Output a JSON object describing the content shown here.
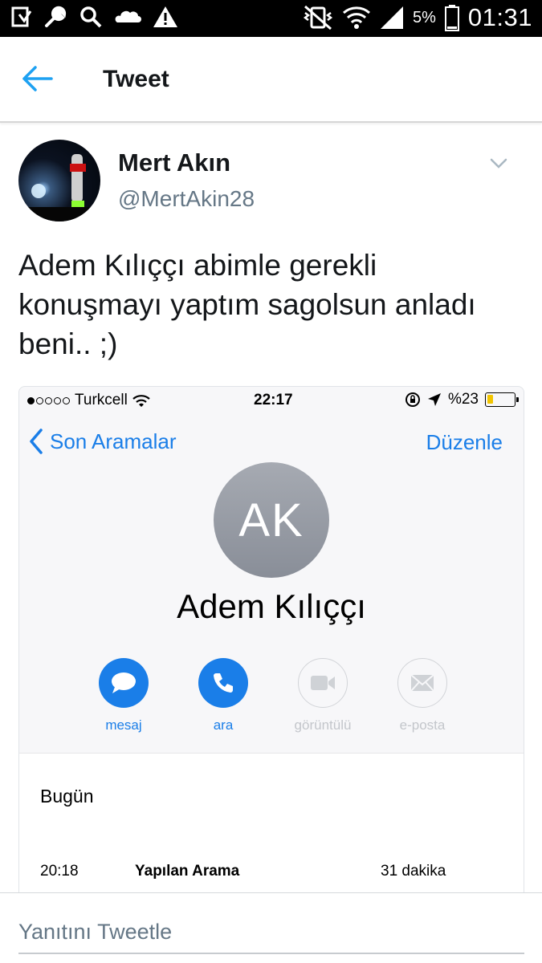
{
  "status_bar": {
    "time": "01:31",
    "battery_percent": "5%",
    "left_icons": [
      "download-icon",
      "wrench-icon",
      "search-icon",
      "cloud-icon",
      "warning-icon"
    ],
    "right_icons": [
      "vibrate-icon",
      "wifi-icon",
      "signal-icon",
      "battery-icon"
    ]
  },
  "header": {
    "title": "Tweet",
    "back_icon": "back-arrow-icon",
    "accent": "#1da1f2"
  },
  "tweet": {
    "author_name": "Mert Akın",
    "author_handle": "@MertAkin28",
    "menu_icon": "chevron-down-icon",
    "text": "Adem Kılıççı abimle gerekli konuşmayı yaptım sagolsun anladı beni.. ;)"
  },
  "media": {
    "ios_status": {
      "carrier": "Turkcell",
      "time": "22:17",
      "battery": "%23",
      "battery_level": 0.23
    },
    "nav": {
      "back_label": "Son Aramalar",
      "edit_label": "Düzenle"
    },
    "contact": {
      "initials": "AK",
      "name": "Adem Kılıççı"
    },
    "actions": [
      {
        "label": "mesaj",
        "icon": "message-icon",
        "enabled": true
      },
      {
        "label": "ara",
        "icon": "phone-icon",
        "enabled": true
      },
      {
        "label": "görüntülü",
        "icon": "video-icon",
        "enabled": false
      },
      {
        "label": "e-posta",
        "icon": "mail-icon",
        "enabled": false
      }
    ],
    "recents": {
      "section": "Bugün",
      "calls": [
        {
          "time": "20:18",
          "type": "Yapılan Arama",
          "duration": "31 dakika"
        }
      ]
    },
    "accent": "#1a7ee8"
  },
  "reply": {
    "placeholder": "Yanıtını Tweetle"
  }
}
